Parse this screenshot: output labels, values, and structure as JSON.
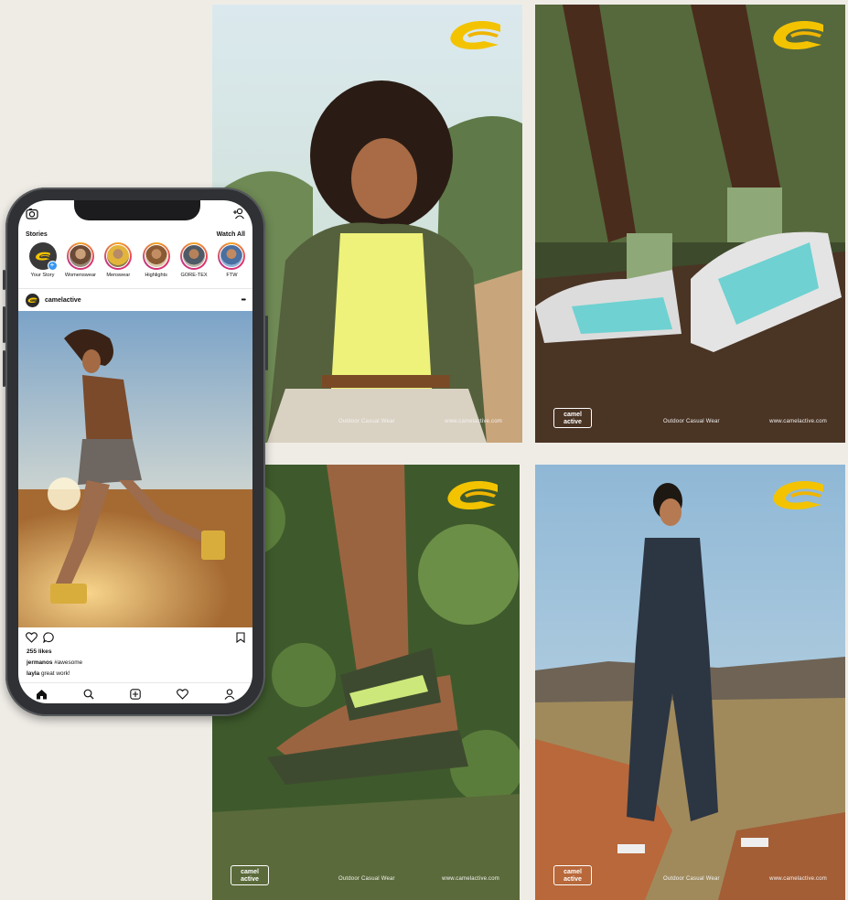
{
  "colors": {
    "background": "#efece6",
    "logo_yellow": "#f3c300",
    "story_blue": "#3897f0"
  },
  "posters": [
    {
      "id": "p1",
      "footer_center": "Outdoor Casual Wear",
      "footer_right": "www.camelactive.com"
    },
    {
      "id": "p2",
      "footer_brand_top": "camel",
      "footer_brand_bottom": "active",
      "footer_center": "Outdoor Casual Wear",
      "footer_right": "www.camelactive.com"
    },
    {
      "id": "p3",
      "footer_brand_top": "camel",
      "footer_brand_bottom": "active",
      "footer_center": "Outdoor Casual Wear",
      "footer_right": "www.camelactive.com"
    },
    {
      "id": "p4",
      "footer_brand_top": "camel",
      "footer_brand_bottom": "active",
      "footer_center": "Outdoor Casual Wear",
      "footer_right": "www.camelactive.com"
    }
  ],
  "phone": {
    "stories_label": "Stories",
    "watch_all_label": "Watch All",
    "stories": [
      {
        "label": "Your Story"
      },
      {
        "label": "Womenswear"
      },
      {
        "label": "Menswear"
      },
      {
        "label": "Highlights"
      },
      {
        "label": "GORE-TEX"
      },
      {
        "label": "FTW"
      }
    ],
    "post": {
      "account": "camelactive",
      "more": "•••",
      "likes": "255 likes",
      "comments": [
        {
          "user": "jermanos",
          "text": "#awesome"
        },
        {
          "user": "layla",
          "text": "great work!"
        }
      ]
    },
    "icons": [
      "camera-icon",
      "add-user-icon",
      "heart-icon",
      "comment-icon",
      "bookmark-icon",
      "home-icon",
      "search-icon",
      "add-post-icon",
      "activity-icon",
      "profile-icon"
    ]
  }
}
